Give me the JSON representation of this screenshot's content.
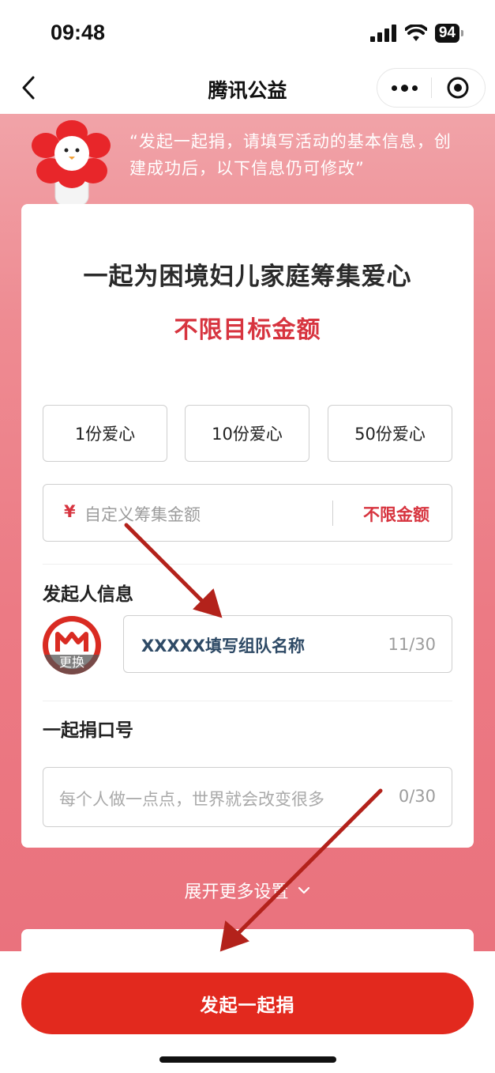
{
  "status_bar": {
    "time": "09:48",
    "battery": "94"
  },
  "nav": {
    "title": "腾讯公益"
  },
  "hero": {
    "quote_line1": "“发起一起捐，请填写活动的基本信息，创",
    "quote_line2": "建成功后，以下信息仍可修改”"
  },
  "campaign": {
    "title": "一起为困境妇儿家庭筹集爱心",
    "target": "不限目标金额"
  },
  "amount_options": [
    "1份爱心",
    "10份爱心",
    "50份爱心"
  ],
  "custom_amount": {
    "currency": "¥",
    "placeholder": "自定义筹集金额",
    "unlimited_label": "不限金额"
  },
  "initiator": {
    "label": "发起人信息",
    "avatar_badge": "更换",
    "team_name_value": "XXXXX填写组队名称",
    "counter": "11/30"
  },
  "slogan": {
    "label": "一起捐口号",
    "placeholder": "每个人做一点点，世界就会改变很多",
    "counter": "0/30"
  },
  "expand_more": "展开更多设置",
  "primary_button": "发起一起捐",
  "colors": {
    "accent": "#e2291e",
    "highlight_text": "#d7343f",
    "annotation_arrow": "#b3221b"
  }
}
